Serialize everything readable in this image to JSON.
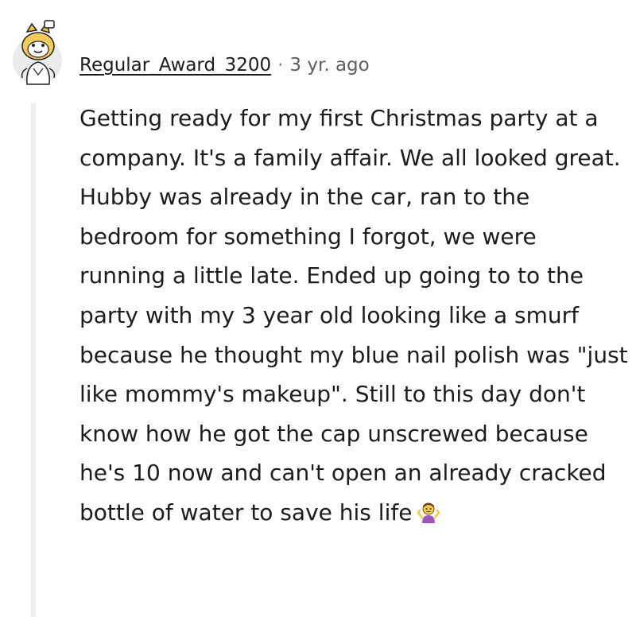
{
  "comment": {
    "username": "Regular_Award_3200",
    "separator": "·",
    "timestamp": "3 yr. ago",
    "body": "Getting ready for my first Christmas party at a company. It's a family affair. We all looked great. Hubby was already in the car, ran to the bedroom for something I forgot, we were running a little late. Ended up going to to the party with my 3 year old looking like a smurf because he thought my blue nail polish was \"just like mommy's makeup\". Still to this day don't know how he got the cap unscrewed because he's 10 now and can't open an already cracked bottle of water to save his life",
    "emoji_icon": "person-shrugging-emoji"
  },
  "colors": {
    "text": "#1c1c1c",
    "meta": "#5f5f5f",
    "thread_line": "#ededed"
  }
}
